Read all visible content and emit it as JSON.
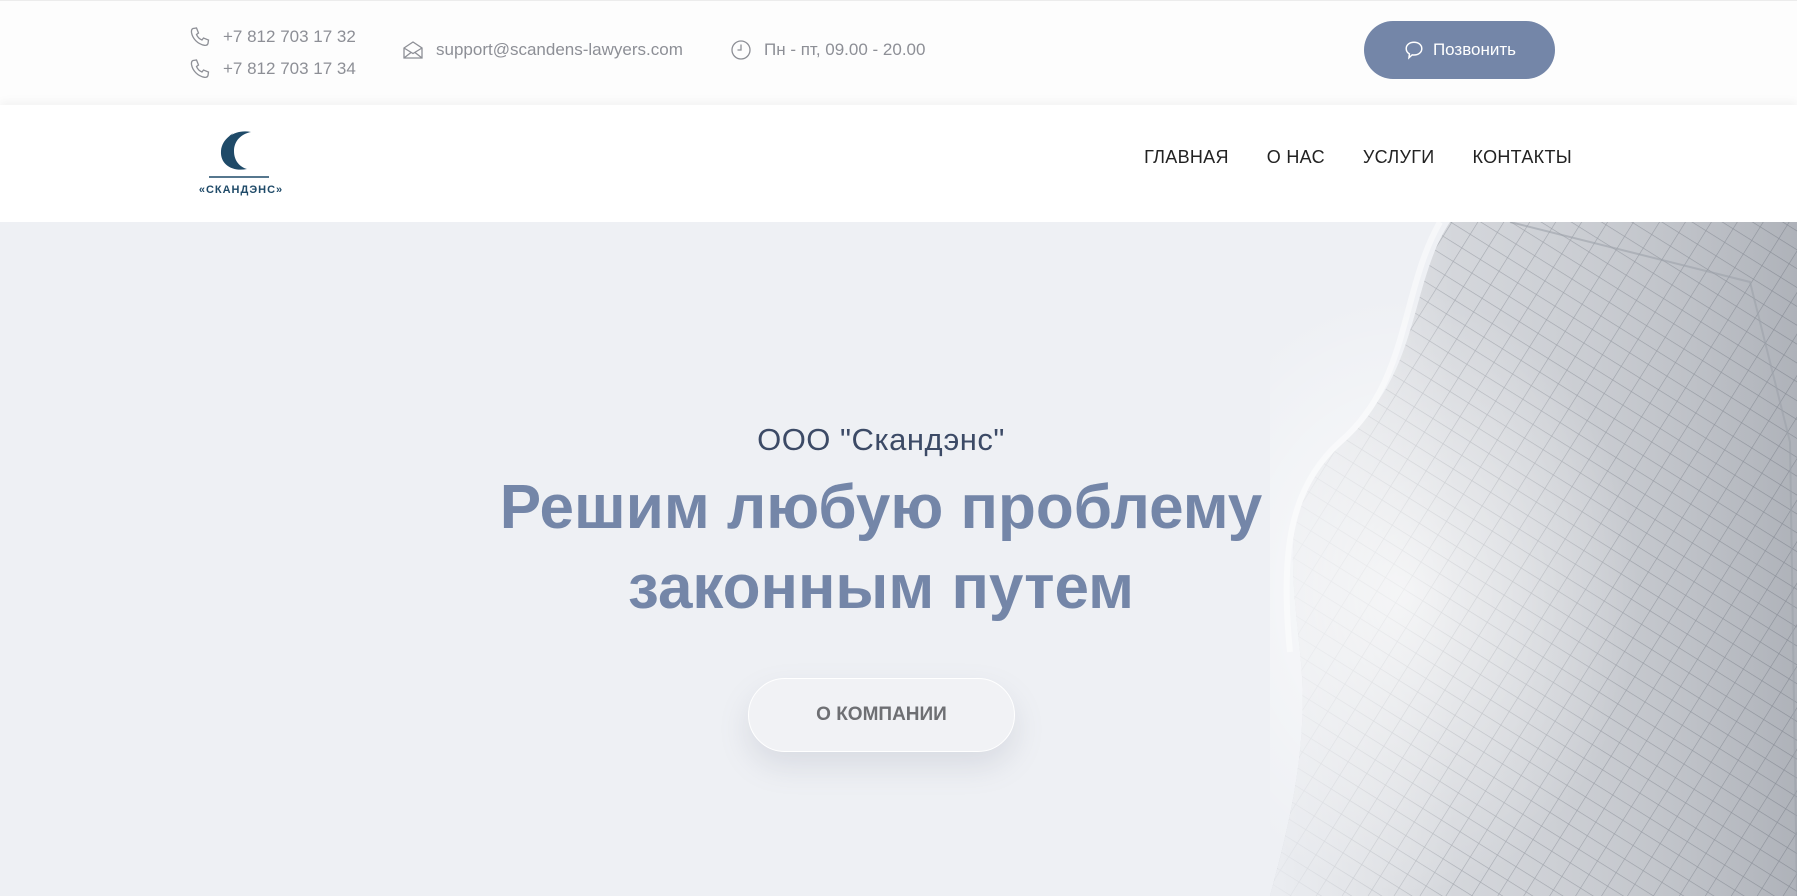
{
  "topbar": {
    "phones": [
      "+7 812 703 17 32",
      "+7 812 703 17 34"
    ],
    "email": "support@scandens-lawyers.com",
    "hours": "Пн - пт, 09.00 - 20.00",
    "call_label": "Позвонить"
  },
  "header": {
    "logo_text": "«СКАНДЭНС»",
    "nav": [
      "ГЛАВНАЯ",
      "О НАС",
      "УСЛУГИ",
      "КОНТАКТЫ"
    ]
  },
  "hero": {
    "subtitle": "ООО \"Скандэнс\"",
    "title_line1": "Решим любую проблему",
    "title_line2": "законным путем",
    "button_label": "О КОМПАНИИ"
  },
  "colors": {
    "accent": "#7486a8",
    "logo": "#1f4a68",
    "hero_bg": "#eef0f4",
    "subtitle": "#3c4a66"
  },
  "icons": {
    "phone": "phone-icon",
    "email": "envelope-icon",
    "hours": "clock-icon",
    "call": "chat-bubble-icon"
  }
}
